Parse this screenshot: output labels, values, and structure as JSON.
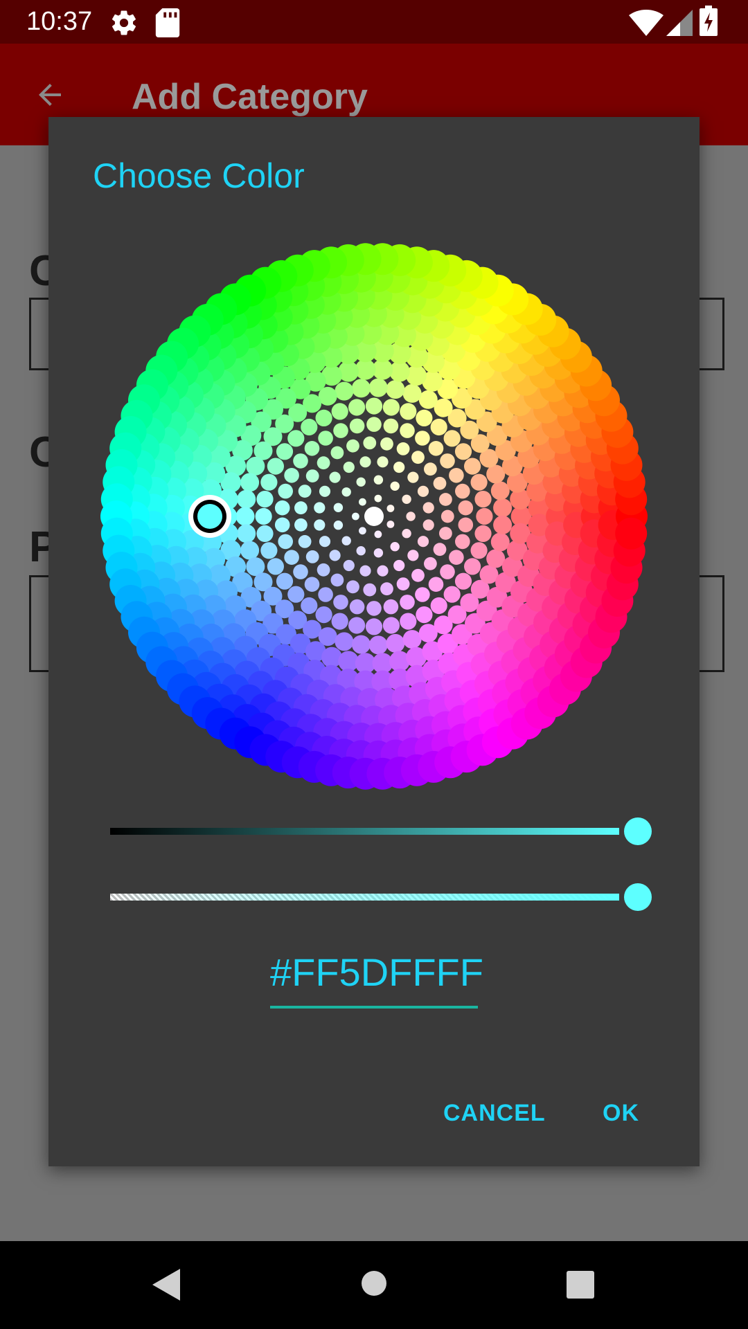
{
  "status_bar": {
    "time": "10:37",
    "icons": [
      "gear-icon",
      "sd-card-icon",
      "wifi-icon",
      "signal-icon",
      "battery-charging-icon"
    ]
  },
  "app_bar": {
    "title": "Add Category",
    "back_icon": "arrow-left-icon"
  },
  "background_form": {
    "labels": [
      "C",
      "C",
      "P"
    ]
  },
  "dialog": {
    "title": "Choose Color",
    "selected_color": "#5DFFFF",
    "lightness_slider_value": 1.0,
    "alpha_slider_value": 1.0,
    "hex_value": "#FF5DFFFF",
    "cancel_label": "CANCEL",
    "ok_label": "OK"
  },
  "nav_bar": {
    "icons": [
      "back-triangle-icon",
      "home-circle-icon",
      "recents-square-icon"
    ]
  },
  "colors": {
    "accent": "#1FD3F5",
    "dialog_bg": "#3A3A3A",
    "status_bar": "#550000",
    "app_bar": "#7A0000"
  }
}
